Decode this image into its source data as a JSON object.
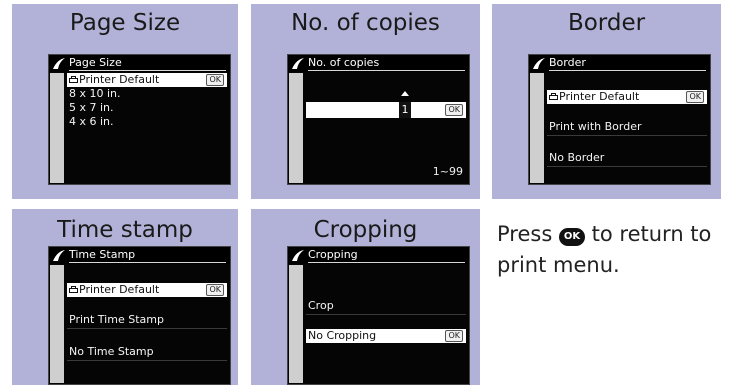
{
  "ok_badge": "OK",
  "panels": {
    "page_size": {
      "caption": "Page Size",
      "screen_title": "Page Size",
      "items": [
        "Printer Default",
        "8 x 10 in.",
        "5 x 7 in.",
        "4 x 6 in."
      ]
    },
    "copies": {
      "caption": "No. of copies",
      "screen_title": "No. of copies",
      "value": "1",
      "range": "1~99"
    },
    "border": {
      "caption": "Border",
      "screen_title": "Border",
      "items": [
        "Printer Default",
        "Print with Border",
        "No Border"
      ]
    },
    "time_stamp": {
      "caption": "Time stamp",
      "screen_title": "Time Stamp",
      "items": [
        "Printer Default",
        "Print Time Stamp",
        "No Time Stamp"
      ]
    },
    "cropping": {
      "caption": "Cropping",
      "screen_title": "Cropping",
      "items": [
        "Crop",
        "No Cropping"
      ]
    }
  },
  "instruction": {
    "before": "Press",
    "after": "to return to print menu."
  }
}
